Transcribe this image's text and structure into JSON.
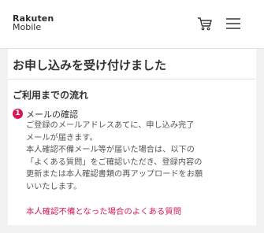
{
  "header": {
    "logo_top": "Rakuten",
    "logo_bottom": "Mobile",
    "cart_icon": "cart-icon",
    "menu_icon": "hamburger-menu-icon"
  },
  "main": {
    "title": "お申し込みを受け付けました",
    "section_title": "ご利用までの流れ",
    "step": {
      "number": "1",
      "title": "メールの確認",
      "body_lines": [
        "ご登録のメールアドレスあてに、申し込み完了",
        "メールが届きます。",
        "本人確認不備メール等が届いた場合は、以下の",
        "「よくある質問」をご確認いただき、登録内容の",
        "更新または本人確認書類の再アップロードをお願",
        "いいたします。"
      ]
    },
    "faq_link": "本人確認不備となった場合のよくある質問"
  },
  "colors": {
    "accent": "#d6175e",
    "background": "#f2f2f2",
    "card": "#ffffff"
  }
}
